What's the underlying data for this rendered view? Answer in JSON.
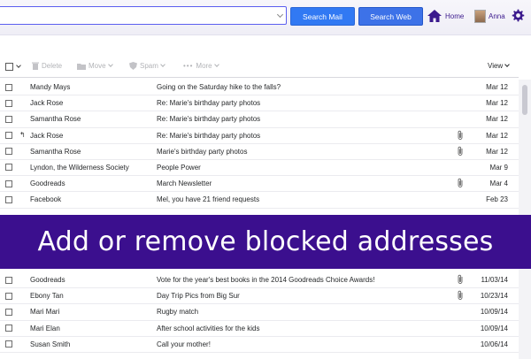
{
  "header": {
    "search_mail_label": "Search Mail",
    "search_web_label": "Search Web",
    "home_label": "Home",
    "user_name": "Anna",
    "icons": [
      "home-icon",
      "avatar",
      "gear-icon"
    ],
    "accent_color": "#3b0f8e"
  },
  "toolbar": {
    "delete_label": "Delete",
    "move_label": "Move",
    "spam_label": "Spam",
    "more_label": "More",
    "view_label": "View"
  },
  "messages_top": [
    {
      "from": "Mandy Mays",
      "subject": "Going on the Saturday hike to the falls?",
      "date": "Mar 12",
      "replied": false,
      "attachment": false
    },
    {
      "from": "Jack Rose",
      "subject": "Re: Marie's birthday party photos",
      "date": "Mar 12",
      "replied": false,
      "attachment": false
    },
    {
      "from": "Samantha Rose",
      "subject": "Re: Marie's birthday party photos",
      "date": "Mar 12",
      "replied": false,
      "attachment": false
    },
    {
      "from": "Jack Rose",
      "subject": "Re: Marie's birthday party photos",
      "date": "Mar 12",
      "replied": true,
      "attachment": true
    },
    {
      "from": "Samantha Rose",
      "subject": "Marie's birthday party photos",
      "date": "Mar 12",
      "replied": false,
      "attachment": true
    },
    {
      "from": "Lyndon, the Wilderness Society",
      "subject": "People Power",
      "date": "Mar 9",
      "replied": false,
      "attachment": false
    },
    {
      "from": "Goodreads",
      "subject": "March Newsletter",
      "date": "Mar 4",
      "replied": false,
      "attachment": true
    },
    {
      "from": "Facebook",
      "subject": "Mel, you have 21 friend requests",
      "date": "Feb 23",
      "replied": false,
      "attachment": false
    }
  ],
  "banner": {
    "text": "Add or remove blocked addresses"
  },
  "messages_bottom": [
    {
      "from": "Goodreads",
      "subject": "Vote for the year's best books in the 2014 Goodreads Choice Awards!",
      "date": "11/03/14",
      "attachment": true
    },
    {
      "from": "Ebony Tan",
      "subject": "Day Trip Pics from Big Sur",
      "date": "10/23/14",
      "attachment": true
    },
    {
      "from": "Mari Mari",
      "subject": "Rugby match",
      "date": "10/09/14",
      "attachment": false
    },
    {
      "from": "Mari Elan",
      "subject": "After school activities for the kids",
      "date": "10/09/14",
      "attachment": false
    },
    {
      "from": "Susan Smith",
      "subject": "Call your mother!",
      "date": "10/06/14",
      "attachment": false
    }
  ]
}
